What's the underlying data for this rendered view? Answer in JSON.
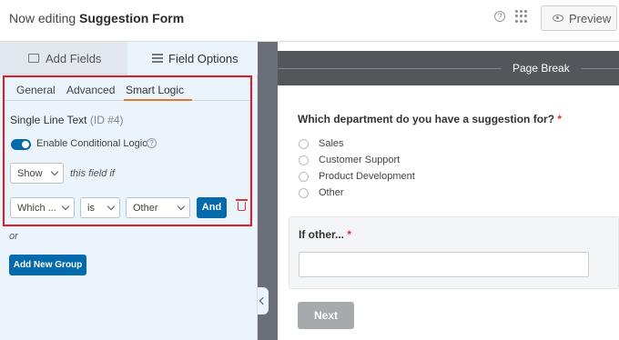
{
  "header": {
    "title_prefix": "Now editing",
    "title_form": "Suggestion Form",
    "help_icon": "?",
    "preview_label": "Preview"
  },
  "panel": {
    "tabs": [
      {
        "label": "Add Fields",
        "icon": "list-icon"
      },
      {
        "label": "Field Options",
        "icon": "sliders-icon"
      }
    ],
    "subtabs": [
      "General",
      "Advanced",
      "Smart Logic"
    ],
    "active_subtab": "Smart Logic",
    "field_title": "Single Line Text",
    "field_id": "(ID #4)",
    "toggle_label": "Enable Conditional Logic",
    "toggle_on": true,
    "help_icon": "?",
    "action_select": "Show",
    "action_suffix": "this field if",
    "rule": {
      "field": "Which ...",
      "operator": "is",
      "value": "Other"
    },
    "and_label": "And",
    "or_label": "or",
    "add_group_label": "Add New Group"
  },
  "preview": {
    "page_break_label": "Page Break",
    "question": "Which department do you have a suggestion for?",
    "required_mark": "*",
    "options": [
      "Sales",
      "Customer Support",
      "Product Development",
      "Other"
    ],
    "conditional_label": "If other...",
    "next_label": "Next"
  },
  "colors": {
    "accent": "#036aab",
    "highlight_border": "#e01b24",
    "active_tab_underline": "#e27730"
  }
}
